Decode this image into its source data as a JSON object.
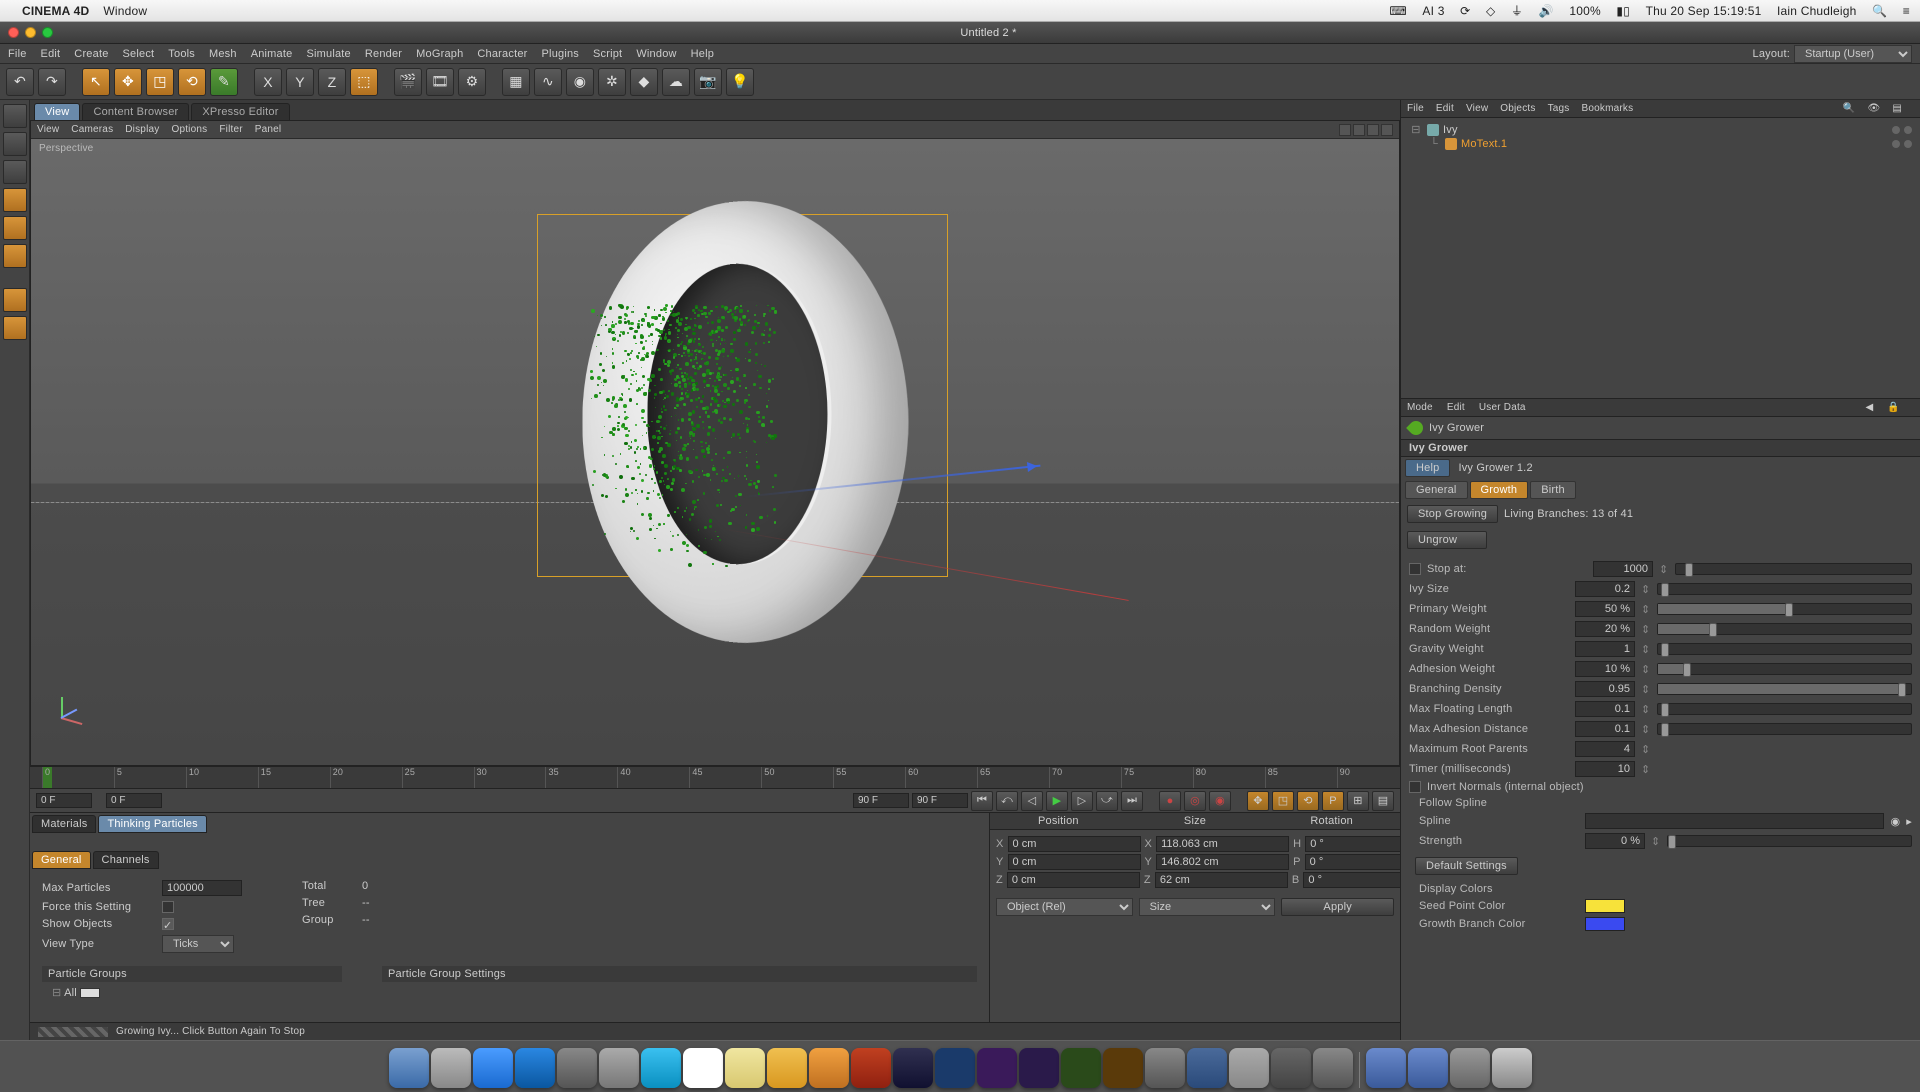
{
  "mac": {
    "app": "CINEMA 4D",
    "menu": [
      "Window"
    ],
    "right": {
      "ai": "AI 3",
      "battery": "100%",
      "datetime": "Thu 20 Sep  15:19:51",
      "user": "Iain Chudleigh"
    }
  },
  "window": {
    "title": "Untitled 2 *"
  },
  "app_menu": [
    "File",
    "Edit",
    "Create",
    "Select",
    "Tools",
    "Mesh",
    "Animate",
    "Simulate",
    "Render",
    "MoGraph",
    "Character",
    "Plugins",
    "Script",
    "Window",
    "Help"
  ],
  "layout": {
    "label": "Layout:",
    "value": "Startup (User)"
  },
  "view_tabs": [
    "View",
    "Content Browser",
    "XPresso Editor"
  ],
  "viewport_menu": [
    "View",
    "Cameras",
    "Display",
    "Options",
    "Filter",
    "Panel"
  ],
  "viewport_label": "Perspective",
  "timeline": {
    "ticks": [
      "0",
      "5",
      "10",
      "15",
      "20",
      "25",
      "30",
      "35",
      "40",
      "45",
      "50",
      "55",
      "60",
      "65",
      "70",
      "75",
      "80",
      "85",
      "90"
    ],
    "end_label": "90 F"
  },
  "transport": {
    "cur": "0 F",
    "start": "0 F",
    "end_a": "90 F",
    "end_b": "90 F"
  },
  "tp": {
    "tabs": [
      "Materials",
      "Thinking Particles"
    ],
    "subtabs": [
      "General",
      "Channels"
    ],
    "max_particles_lbl": "Max Particles",
    "max_particles": "100000",
    "total_lbl": "Total",
    "total": "0",
    "force_lbl": "Force this Setting",
    "tree_lbl": "Tree",
    "tree_val": "--",
    "show_lbl": "Show Objects",
    "group_lbl": "Group",
    "group_val": "--",
    "viewtype_lbl": "View Type",
    "viewtype": "Ticks",
    "pg_header": "Particle Groups",
    "pgs_header": "Particle Group Settings",
    "all": "All"
  },
  "coord": {
    "headers": [
      "Position",
      "Size",
      "Rotation"
    ],
    "pos": {
      "x": "0 cm",
      "y": "0 cm",
      "z": "0 cm"
    },
    "size": {
      "x": "118.063 cm",
      "y": "146.802 cm",
      "z": "62 cm"
    },
    "rot": {
      "h": "0 °",
      "p": "0 °",
      "b": "0 °"
    },
    "mode_a": "Object (Rel)",
    "mode_b": "Size",
    "apply": "Apply"
  },
  "om": {
    "menu": [
      "File",
      "Edit",
      "View",
      "Objects",
      "Tags",
      "Bookmarks"
    ],
    "items": [
      {
        "name": "Ivy",
        "sel": false
      },
      {
        "name": "MoText.1",
        "sel": true,
        "indent": 1
      }
    ]
  },
  "attr": {
    "menu": [
      "Mode",
      "Edit",
      "User Data"
    ],
    "obj_name": "Ivy Grower",
    "group": "Ivy Grower",
    "help_tab": "Help",
    "help_txt": "Ivy Grower 1.2",
    "tabs": [
      "General",
      "Growth",
      "Birth"
    ],
    "stop_btn": "Stop Growing",
    "branches": "Living Branches: 13 of 41",
    "ungrow_btn": "Ungrow",
    "params": {
      "stop_at_lbl": "Stop at:",
      "stop_at": "1000",
      "ivy_size_lbl": "Ivy Size",
      "ivy_size": "0.2",
      "prim_w_lbl": "Primary Weight",
      "prim_w": "50 %",
      "rand_w_lbl": "Random Weight",
      "rand_w": "20 %",
      "grav_w_lbl": "Gravity Weight",
      "grav_w": "1",
      "adh_w_lbl": "Adhesion Weight",
      "adh_w": "10 %",
      "branch_d_lbl": "Branching Density",
      "branch_d": "0.95",
      "maxfloat_lbl": "Max Floating Length",
      "maxfloat": "0.1",
      "maxadh_lbl": "Max Adhesion Distance",
      "maxadh": "0.1",
      "maxroot_lbl": "Maximum Root Parents",
      "maxroot": "4",
      "timer_lbl": "Timer (milliseconds)",
      "timer": "10",
      "invertn_lbl": "Invert Normals (internal object)",
      "follow_lbl": "Follow Spline",
      "spline_lbl": "Spline",
      "strength_lbl": "Strength",
      "strength": "0 %",
      "defaults_btn": "Default Settings",
      "dispcol_lbl": "Display Colors",
      "seed_lbl": "Seed Point Color",
      "seed_col": "#f7e23a",
      "growth_lbl": "Growth Branch Color",
      "growth_col": "#3a4af0"
    }
  },
  "status": "Growing Ivy... Click Button Again To Stop"
}
